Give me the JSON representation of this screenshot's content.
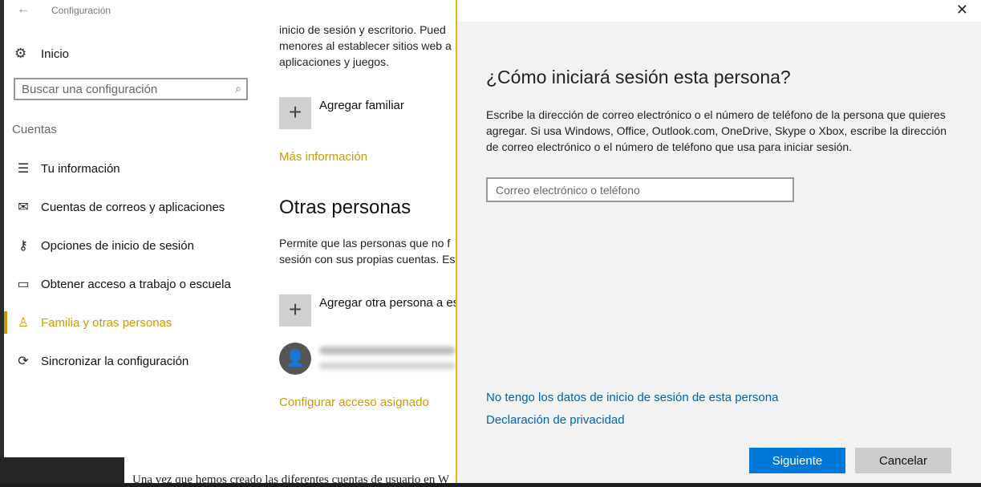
{
  "background": {
    "doc_text": "Una vez que hemos creado las diferentes cuentas de usuario en W"
  },
  "settings": {
    "app_title": "Configuración",
    "home_label": "Inicio",
    "search_placeholder": "Buscar una configuración",
    "section": "Cuentas",
    "nav": [
      {
        "label": "Tu información",
        "icon": "person-card-icon"
      },
      {
        "label": "Cuentas de correos y aplicaciones",
        "icon": "mail-icon"
      },
      {
        "label": "Opciones de inicio de sesión",
        "icon": "key-icon"
      },
      {
        "label": "Obtener acceso a trabajo o escuela",
        "icon": "briefcase-icon"
      },
      {
        "label": "Familia y otras personas",
        "icon": "person-add-icon",
        "active": true
      },
      {
        "label": "Sincronizar la configuración",
        "icon": "sync-icon"
      }
    ],
    "main": {
      "para1_line1": "inicio de sesión y escritorio. Pued",
      "para1_line2": "menores al establecer sitios web a",
      "para1_line3": "aplicaciones y juegos.",
      "add_family": "Agregar familiar",
      "more_info": "Más información",
      "other_people_title": "Otras personas",
      "para2_line1": "Permite que las personas que no f",
      "para2_line2": "sesión con sus propias cuentas. Es",
      "add_other": "Agregar otra persona a es",
      "assigned_access": "Configurar acceso asignado"
    }
  },
  "dialog": {
    "heading": "¿Cómo iniciará sesión esta persona?",
    "description": "Escribe la dirección de correo electrónico o el número de teléfono de la persona que quieres agregar. Si usa Windows, Office, Outlook.com, OneDrive, Skype o Xbox, escribe la dirección de correo electrónico o el número de teléfono que usa para iniciar sesión.",
    "input_placeholder": "Correo electrónico o teléfono",
    "no_data_link": "No tengo los datos de inicio de sesión de esta persona",
    "privacy_link": "Declaración de privacidad",
    "next_button": "Siguiente",
    "cancel_button": "Cancelar"
  },
  "colors": {
    "accent": "#cc9a00",
    "link": "#0063b1",
    "primary_button": "#0078d7"
  }
}
